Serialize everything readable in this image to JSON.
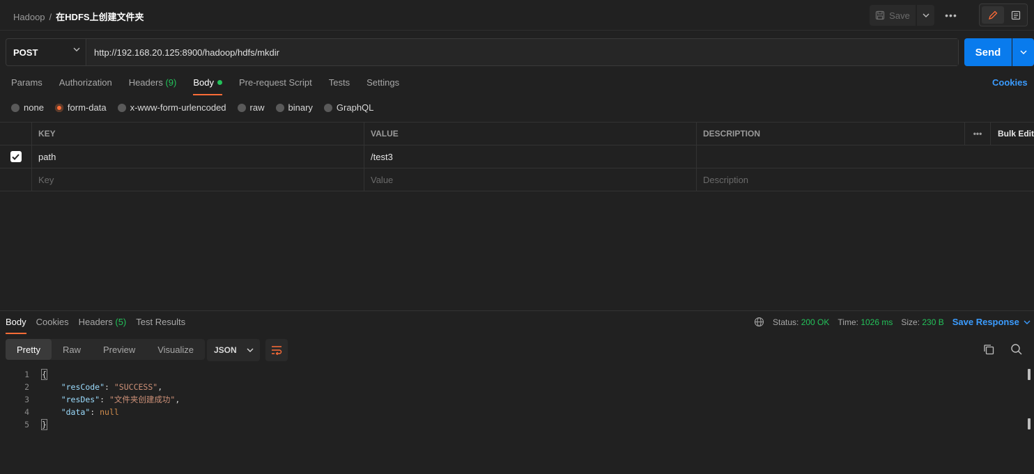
{
  "breadcrumb": {
    "parent": "Hadoop",
    "separator": "/",
    "current": "在HDFS上创建文件夹"
  },
  "toolbar": {
    "save_label": "Save",
    "more": "•••"
  },
  "request": {
    "method": "POST",
    "url": "http://192.168.20.125:8900/hadoop/hdfs/mkdir",
    "send_label": "Send"
  },
  "request_tabs": [
    {
      "label": "Params"
    },
    {
      "label": "Authorization"
    },
    {
      "label": "Headers",
      "count": "(9)"
    },
    {
      "label": "Body"
    },
    {
      "label": "Pre-request Script"
    },
    {
      "label": "Tests"
    },
    {
      "label": "Settings"
    }
  ],
  "cookies_label": "Cookies",
  "body_types": [
    "none",
    "form-data",
    "x-www-form-urlencoded",
    "raw",
    "binary",
    "GraphQL"
  ],
  "body_type_selected": "form-data",
  "kv_table": {
    "headers": {
      "key": "KEY",
      "value": "VALUE",
      "description": "DESCRIPTION",
      "more": "•••",
      "bulk_edit": "Bulk Edit"
    },
    "rows": [
      {
        "key": "path",
        "value": "/test3",
        "description": "",
        "checked": true
      }
    ],
    "placeholders": {
      "key": "Key",
      "value": "Value",
      "description": "Description"
    }
  },
  "response": {
    "tabs": [
      {
        "label": "Body"
      },
      {
        "label": "Cookies"
      },
      {
        "label": "Headers",
        "count": "(5)"
      },
      {
        "label": "Test Results"
      }
    ],
    "status_label": "Status:",
    "status": "200 OK",
    "time_label": "Time:",
    "time": "1026 ms",
    "size_label": "Size:",
    "size": "230 B",
    "save_response": "Save Response",
    "views": [
      "Pretty",
      "Raw",
      "Preview",
      "Visualize"
    ],
    "view_selected": "Pretty",
    "format": "JSON",
    "lines": [
      {
        "n": "1",
        "open": "{"
      },
      {
        "n": "2",
        "key": "\"resCode\"",
        "value": "\"SUCCESS\"",
        "comma": ","
      },
      {
        "n": "3",
        "key": "\"resDes\"",
        "value": "\"文件夹创建成功\"",
        "comma": ","
      },
      {
        "n": "4",
        "key": "\"data\"",
        "value": "null",
        "comma": ""
      },
      {
        "n": "5",
        "close": "}"
      }
    ]
  },
  "colors": {
    "accent": "#ff6c37",
    "primary": "#097bed",
    "link": "#3b9cff",
    "success": "#23c25a"
  }
}
